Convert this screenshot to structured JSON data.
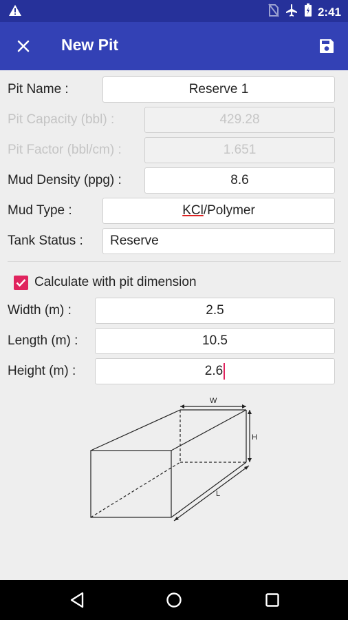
{
  "status_bar": {
    "time": "2:41",
    "icons": [
      "warning-icon",
      "no-sim-icon",
      "airplane-icon",
      "battery-icon"
    ]
  },
  "app_bar": {
    "title": "New Pit",
    "close_icon": "close-icon",
    "save_icon": "save-icon"
  },
  "form": {
    "pit_name": {
      "label": "Pit Name :",
      "value": "Reserve 1"
    },
    "pit_capacity": {
      "label": "Pit Capacity (bbl) :",
      "value": "429.28"
    },
    "pit_factor": {
      "label": "Pit Factor (bbl/cm) :",
      "value": "1.651"
    },
    "mud_density": {
      "label": "Mud Density (ppg) :",
      "value": "8.6"
    },
    "mud_type": {
      "label": "Mud Type :",
      "value_part1": "KCl",
      "value_part2": "/Polymer"
    },
    "tank_status": {
      "label": "Tank Status :",
      "value": "Reserve"
    }
  },
  "dimensions": {
    "checkbox_label": "Calculate with pit dimension",
    "checked": true,
    "width": {
      "label": "Width (m) :",
      "value": "2.5"
    },
    "length": {
      "label": "Length (m) :",
      "value": "10.5"
    },
    "height": {
      "label": "Height (m) :",
      "value": "2.6"
    }
  },
  "diagram_labels": {
    "w": "W",
    "h": "H",
    "l": "L"
  },
  "colors": {
    "status_bar": "#26319a",
    "app_bar": "#3341b5",
    "accent": "#e0245e",
    "background": "#eeeeee"
  }
}
